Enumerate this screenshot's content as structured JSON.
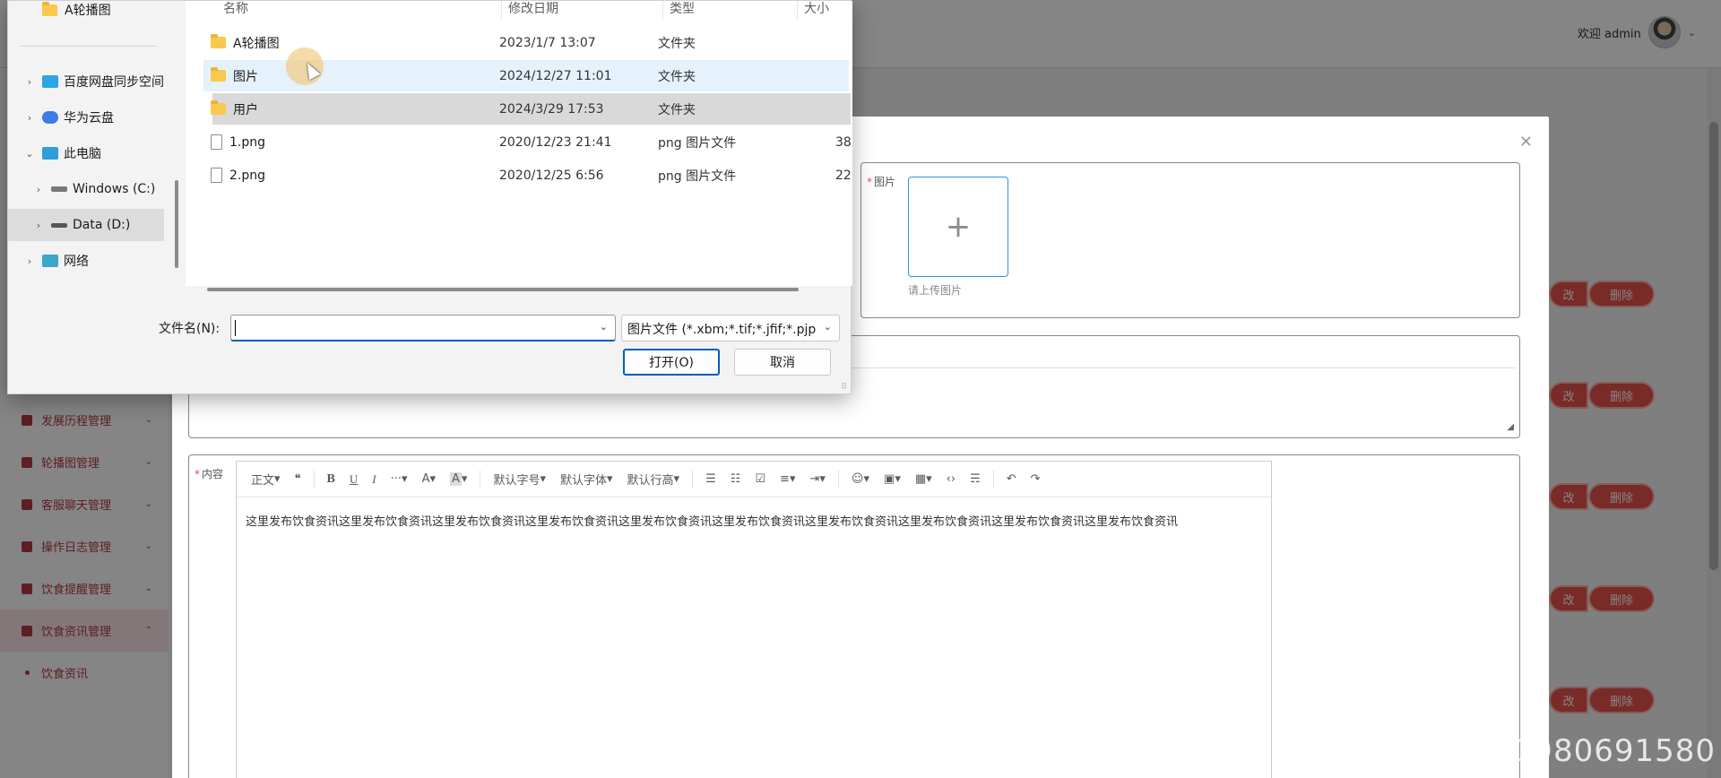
{
  "app": {
    "welcome": "欢迎 admin",
    "sidebar": [
      {
        "label": "发展历程管理"
      },
      {
        "label": "轮播图管理"
      },
      {
        "label": "客服聊天管理"
      },
      {
        "label": "操作日志管理"
      },
      {
        "label": "饮食提醒管理"
      },
      {
        "label": "饮食资讯管理"
      }
    ],
    "sidebar_sub": "饮食资讯",
    "row_buttons": {
      "edit": "改",
      "delete": "删除"
    }
  },
  "modal": {
    "image_label": "图片",
    "upload_plus": "+",
    "upload_hint": "请上传图片",
    "content_label": "内容",
    "editor_toolbar": [
      "正文",
      "❝",
      "B",
      "U",
      "I",
      "···",
      "A",
      "A",
      "默认字号",
      "默认字体",
      "默认行高",
      "☰",
      "☷",
      "☑",
      "≡",
      "⇥",
      "☺",
      "▣",
      "▦",
      "‹›",
      "☴",
      "↶",
      "↷"
    ],
    "editor_content": "这里发布饮食资讯这里发布饮食资讯这里发布饮食资讯这里发布饮食资讯这里发布饮食资讯这里发布饮食资讯这里发布饮食资讯这里发布饮食资讯这里发布饮食资讯这里发布饮食资讯"
  },
  "file_dialog": {
    "nav": [
      {
        "label": "A轮播图",
        "icon": "folder-icon"
      },
      {
        "label": "百度网盘同步空间",
        "icon": "baidu-cloud-icon"
      },
      {
        "label": "华为云盘",
        "icon": "huawei-cloud-icon"
      },
      {
        "label": "此电脑",
        "icon": "computer-icon"
      },
      {
        "label": "Windows (C:)",
        "icon": "drive-icon"
      },
      {
        "label": "Data (D:)",
        "icon": "drive-icon"
      },
      {
        "label": "网络",
        "icon": "network-icon"
      }
    ],
    "columns": {
      "name": "名称",
      "date": "修改日期",
      "type": "类型",
      "size": "大小"
    },
    "files": [
      {
        "name": "A轮播图",
        "date": "2023/1/7 13:07",
        "type": "文件夹",
        "size": "",
        "kind": "folder"
      },
      {
        "name": "图片",
        "date": "2024/12/27 11:01",
        "type": "文件夹",
        "size": "",
        "kind": "folder"
      },
      {
        "name": "用户",
        "date": "2024/3/29 17:53",
        "type": "文件夹",
        "size": "",
        "kind": "folder"
      },
      {
        "name": "1.png",
        "date": "2020/12/23 21:41",
        "type": "png 图片文件",
        "size": "38",
        "kind": "file"
      },
      {
        "name": "2.png",
        "date": "2020/12/25 6:56",
        "type": "png 图片文件",
        "size": "22",
        "kind": "file"
      }
    ],
    "filename_label": "文件名(N):",
    "filename_value": "",
    "filetype_value": "图片文件 (*.xbm;*.tif;*.jfif;*.pjp",
    "open_label": "打开(O)",
    "cancel_label": "取消"
  },
  "watermark": "CSDN @QQ1980691580",
  "colors": {
    "accent": "#e8534b",
    "dialog_focus": "#005fb8",
    "folder": "#f8c94a"
  }
}
